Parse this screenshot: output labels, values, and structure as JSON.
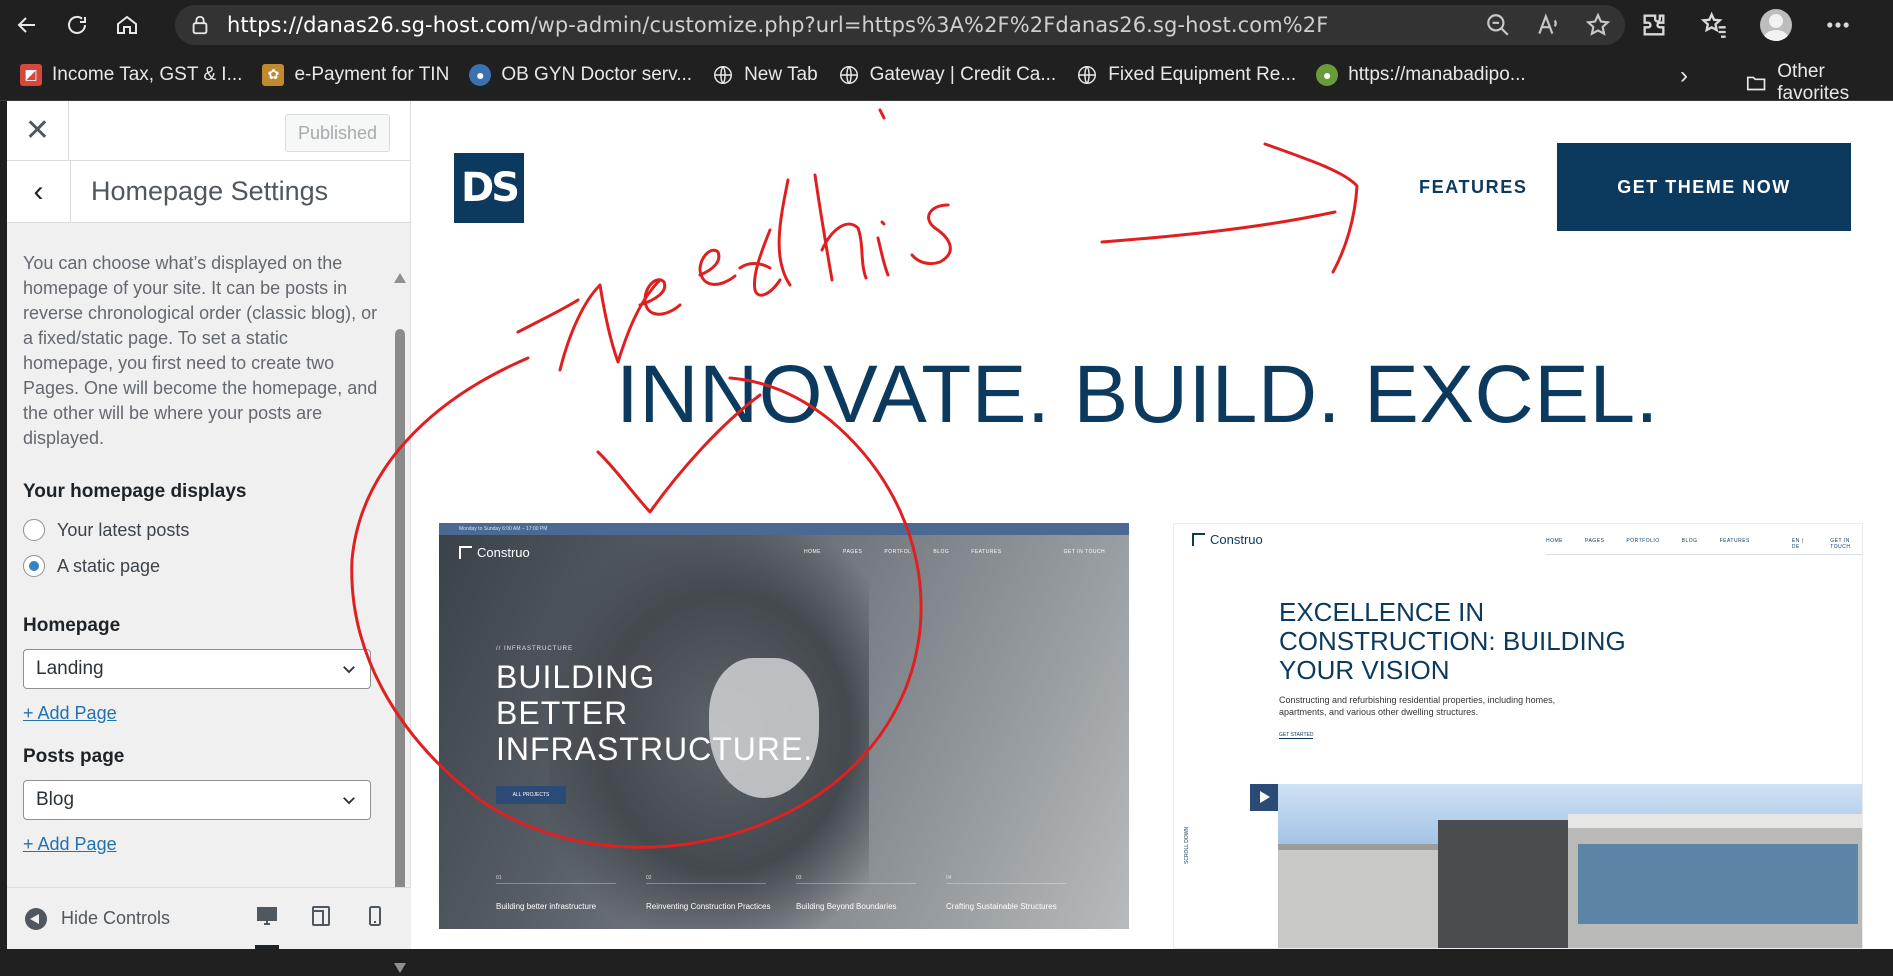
{
  "browser": {
    "url_host": "https://danas26.sg-host.com",
    "url_path": "/wp-admin/customize.php?url=https%3A%2F%2Fdanas26.sg-host.com%2F",
    "bookmarks": [
      {
        "label": "Income Tax, GST & I...",
        "color": "#d3493b"
      },
      {
        "label": "e-Payment for TIN",
        "color": "#c28a2e"
      },
      {
        "label": "OB GYN Doctor serv...",
        "color": "#3a72b0"
      },
      {
        "label": "New Tab",
        "color": "#202020"
      },
      {
        "label": "Gateway | Credit Ca...",
        "color": "#202020"
      },
      {
        "label": "Fixed Equipment Re...",
        "color": "#202020"
      },
      {
        "label": "https://manabadipo...",
        "color": "#6a9b3a"
      }
    ],
    "other_favorites": "Other favorites"
  },
  "customizer": {
    "published_label": "Published",
    "section_title": "Homepage Settings",
    "description": "You can choose what’s displayed on the homepage of your site. It can be posts in reverse chronological order (classic blog), or a fixed/static page. To set a static homepage, you first need to create two Pages. One will become the homepage, and the other will be where your posts are displayed.",
    "homepage_displays_label": "Your homepage displays",
    "radio_latest": "Your latest posts",
    "radio_static": "A static page",
    "homepage_label": "Homepage",
    "homepage_value": "Landing",
    "add_page_1": "+ Add Page",
    "posts_page_label": "Posts page",
    "posts_page_value": "Blog",
    "add_page_2": "+ Add Page",
    "hide_controls": "Hide Controls"
  },
  "preview": {
    "logo": "DS",
    "nav_features": "FEATURES",
    "cta": "GET THEME NOW",
    "hero_title": "INNOVATE. BUILD. EXCEL.",
    "brand_color": "#0b3a5e",
    "card1": {
      "brand": "Construo",
      "topbar": "Monday to Sunday 6:00 AM – 17:00 PM",
      "menu": [
        "HOME",
        "PAGES",
        "PORTFOL",
        "BLOG",
        "FEATURES",
        "GET IN TOUCH"
      ],
      "small_cap": "// INFRASTRUCTURE",
      "headline_1": "BUILDING",
      "headline_2": "BETTER",
      "headline_3": "INFRASTRUCTURE.",
      "button": "ALL PROJECTS",
      "features": [
        {
          "num": "01",
          "label": "Building better infrastructure"
        },
        {
          "num": "02",
          "label": "Reinventing Construction Practices"
        },
        {
          "num": "03",
          "label": "Building Beyond Boundaries"
        },
        {
          "num": "04",
          "label": "Crafting Sustainable Structures"
        }
      ]
    },
    "card2": {
      "brand": "Construo",
      "menu": [
        "HOME",
        "PAGES",
        "PORTFOLIO",
        "BLOG",
        "FEATURES",
        "EN | DE",
        "GET IN TOUCH"
      ],
      "headline_1": "EXCELLENCE IN",
      "headline_2": "CONSTRUCTION: BUILDING",
      "headline_3": "YOUR VISION",
      "sub": "Constructing and refurbishing residential properties, including homes, apartments, and various other dwelling structures.",
      "started": "GET STARTED",
      "scroll_down": "SCROLL DOWN"
    }
  },
  "annotation": {
    "color": "#e02020"
  }
}
